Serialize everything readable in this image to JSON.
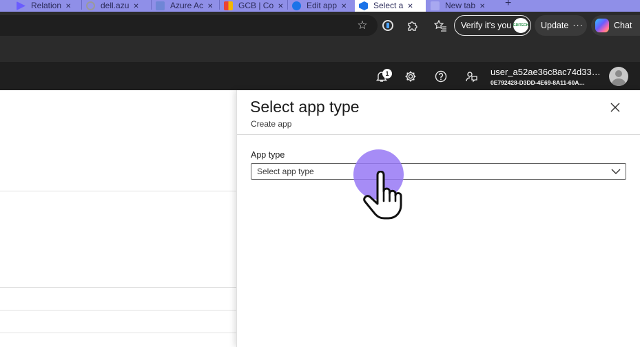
{
  "browser": {
    "tabs": [
      {
        "label": "Relation",
        "icon_color": "#6a5cff"
      },
      {
        "label": "dell.azu",
        "icon_color": "#9a9a9a"
      },
      {
        "label": "Azure Ac",
        "icon_color": "#6f86d6"
      },
      {
        "label": "GCB | Co",
        "icon_color": "#f2b705"
      },
      {
        "label": "Edit app",
        "icon_color": "#1a73e8"
      },
      {
        "label": "Select a",
        "icon_color": "#1a73e8",
        "active": true
      },
      {
        "label": "New tab",
        "icon_color": "#a8a8f0"
      }
    ],
    "verify_label": "Verify it's you",
    "verify_avatar_text": "GRITECH",
    "update_label": "Update",
    "update_dots": "···",
    "chat_label": "Chat"
  },
  "header": {
    "notification_count": "1",
    "user_name": "user_a52ae36c8ac74d33…",
    "user_id": "0E792428-D3DD-4E69-8A11-60A…"
  },
  "panel": {
    "title": "Select app type",
    "subtitle": "Create app",
    "field_label": "App type",
    "select_placeholder": "Select app type"
  },
  "colors": {
    "tabstrip": "#8f8fe8",
    "toolbar": "#2b2b2b",
    "portal_header": "#1f1f1f",
    "cursor_highlight": "#9678f5"
  }
}
